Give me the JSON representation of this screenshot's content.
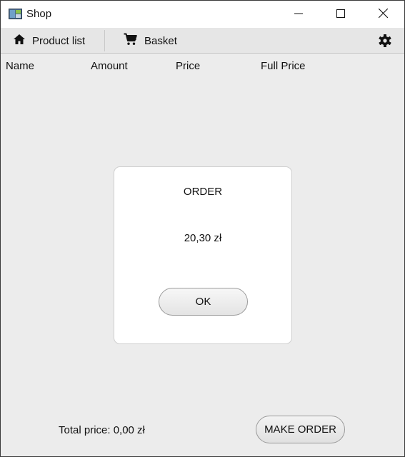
{
  "window": {
    "title": "Shop",
    "app_icon": "app-icon",
    "controls": [
      "minimize-icon",
      "maximize-icon",
      "close-icon"
    ]
  },
  "toolbar": {
    "product_list_label": "Product list",
    "product_list_icon": "home-icon",
    "basket_label": "Basket",
    "basket_icon": "cart-icon",
    "settings_icon": "gear-icon"
  },
  "table": {
    "columns": [
      "Name",
      "Amount",
      "Price",
      "Full Price"
    ]
  },
  "dialog": {
    "title": "ORDER",
    "amount": "20,30 zł",
    "ok_label": "OK"
  },
  "footer": {
    "total_price": "Total price: 0,00 zł",
    "make_order_label": "MAKE ORDER"
  },
  "colors": {
    "background": "#ececec",
    "toolbar": "#e6e6e6",
    "dialog": "#ffffff"
  }
}
